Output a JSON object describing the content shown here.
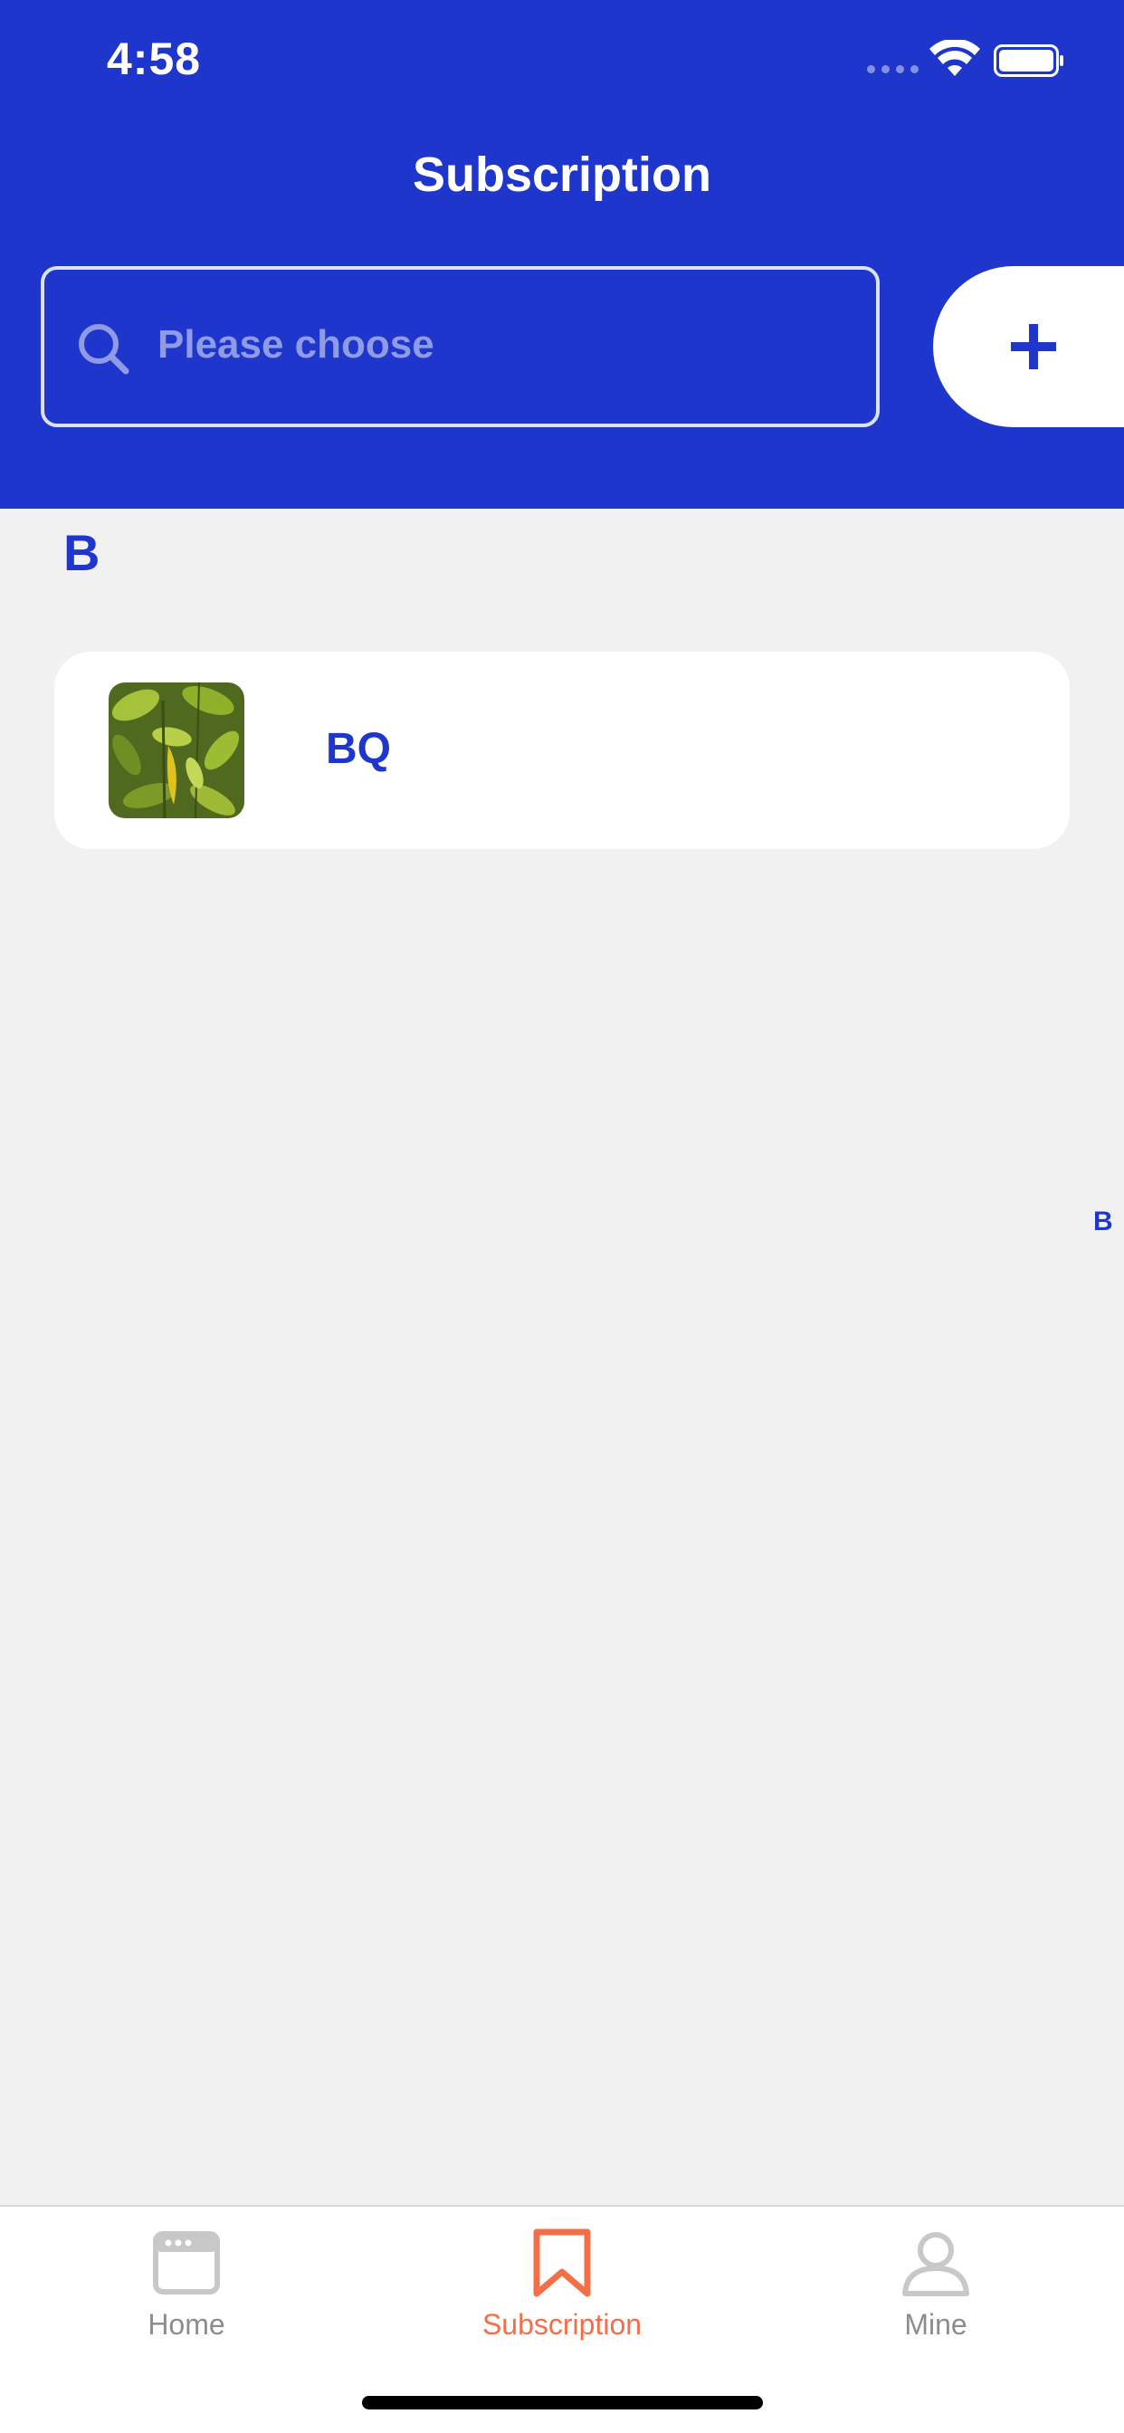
{
  "status_bar": {
    "time": "4:58"
  },
  "header": {
    "title": "Subscription"
  },
  "search": {
    "placeholder": "Please choose",
    "add_symbol": "+"
  },
  "list": {
    "section_letter": "B",
    "items": [
      {
        "label": "BQ",
        "thumbnail": "plant-photo"
      }
    ]
  },
  "index_bar": {
    "letters": [
      "B"
    ]
  },
  "tabbar": {
    "tabs": [
      {
        "label": "Home",
        "icon": "browser-window-icon",
        "active": false
      },
      {
        "label": "Subscription",
        "icon": "bookmark-icon",
        "active": true
      },
      {
        "label": "Mine",
        "icon": "person-icon",
        "active": false
      }
    ]
  },
  "colors": {
    "primary": "#1f36cc",
    "accent": "#f46f47",
    "background": "#f1f1f1",
    "inactive_tab": "#8d8d8d"
  }
}
